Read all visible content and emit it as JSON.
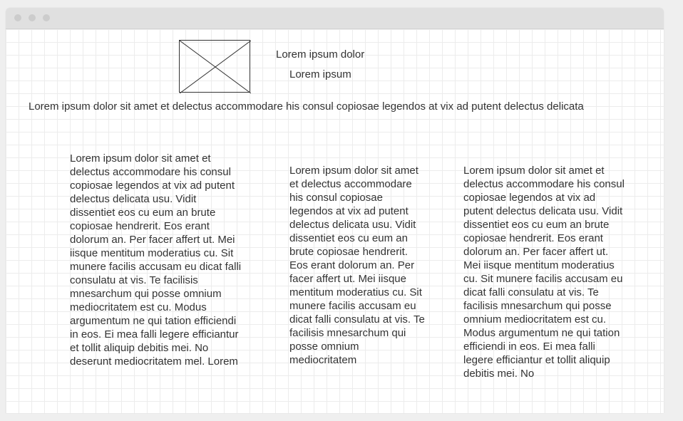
{
  "window": {
    "controls": [
      "close",
      "minimize",
      "maximize"
    ]
  },
  "header": {
    "image_placeholder_icon": "image-placeholder-icon",
    "title": "Lorem ipsum dolor",
    "subtitle": "Lorem ipsum"
  },
  "tagline": "Lorem ipsum dolor sit amet et delectus accommodare his consul copiosae legendos at vix ad putent delectus delicata",
  "columns": [
    {
      "text": "Lorem ipsum dolor sit amet et delectus accommodare his consul copiosae legendos at vix ad putent delectus delicata usu. Vidit dissentiet eos cu eum an brute copiosae hendrerit. Eos erant dolorum an. Per facer affert ut. Mei iisque mentitum moderatius cu. Sit munere facilis accusam eu dicat falli consulatu at vis. Te facilisis mnesarchum qui posse omnium mediocritatem est cu. Modus argumentum ne qui tation efficiendi in eos. Ei mea falli legere efficiantur et tollit aliquip debitis mei. No deserunt mediocritatem mel. Lorem"
    },
    {
      "text": "Lorem ipsum dolor sit amet et delectus accommodare his consul copiosae legendos at vix ad putent delectus delicata usu. Vidit dissentiet eos cu eum an brute copiosae hendrerit. Eos erant dolorum an. Per facer affert ut. Mei iisque mentitum moderatius cu. Sit munere facilis accusam eu dicat falli consulatu at vis. Te facilisis mnesarchum qui posse omnium mediocritatem"
    },
    {
      "text": "Lorem ipsum dolor sit amet et delectus accommodare his consul copiosae legendos at vix ad putent delectus delicata usu. Vidit dissentiet eos cu eum an brute copiosae hendrerit. Eos erant dolorum an. Per facer affert ut. Mei iisque mentitum moderatius cu. Sit munere facilis accusam eu dicat falli consulatu at vis. Te facilisis mnesarchum qui posse omnium mediocritatem est cu. Modus argumentum ne qui tation efficiendi in eos. Ei mea falli legere efficiantur et tollit aliquip debitis mei. No"
    }
  ]
}
